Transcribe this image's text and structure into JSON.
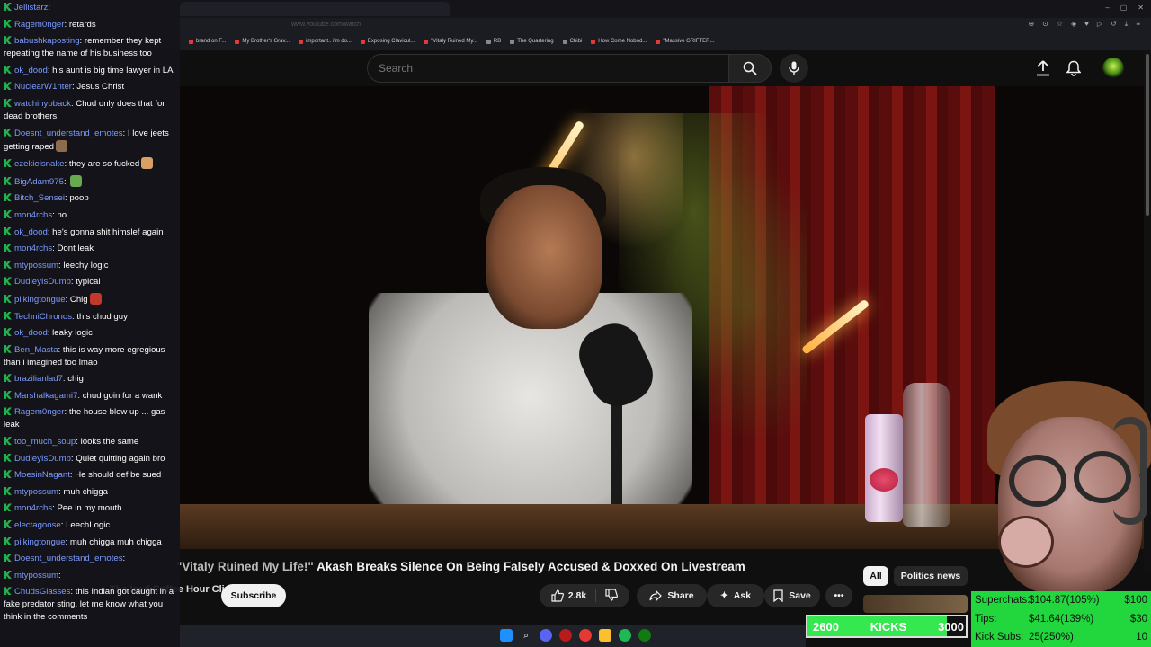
{
  "browser": {
    "url": "www.youtube.com/watch",
    "bookmarks": [
      "brand on F...",
      "My Brother's Grav...",
      "important.. i'm do...",
      "Exposing Clavicul...",
      "\"Vitaly Ruined My...",
      "RB",
      "The Quartering",
      "Chibi",
      "How Come Nobod...",
      "\"Massive GRIFTER..."
    ]
  },
  "header": {
    "search_placeholder": "Search"
  },
  "chat": {
    "messages": [
      {
        "user": "Jellistarz",
        "text": ""
      },
      {
        "user": "Ragem0nger",
        "text": "retards"
      },
      {
        "user": "babushkaposting",
        "text": "remember they kept repeating the name of his business too"
      },
      {
        "user": "ok_dood",
        "text": "his aunt is big time lawyer in LA"
      },
      {
        "user": "NuclearW1nter",
        "text": "Jesus Christ"
      },
      {
        "user": "watchinyoback",
        "text": "Chud only does that for dead brothers"
      },
      {
        "user": "Doesnt_understand_emotes",
        "text": "I love jeets getting raped"
      },
      {
        "user": "ezekielsnake",
        "text": "they are so fucked"
      },
      {
        "user": "BigAdam975",
        "text": ""
      },
      {
        "user": "Bitch_Sensei",
        "text": "poop"
      },
      {
        "user": "mon4rchs",
        "text": "no"
      },
      {
        "user": "ok_dood",
        "text": "he's gonna shit himslef again"
      },
      {
        "user": "mon4rchs",
        "text": "Dont leak"
      },
      {
        "user": "mtypossum",
        "text": "leechy logic"
      },
      {
        "user": "DudleyIsDumb",
        "text": "typical"
      },
      {
        "user": "pilkingtongue",
        "text": "Chig"
      },
      {
        "user": "TechniChronos",
        "text": "this chud guy"
      },
      {
        "user": "ok_dood",
        "text": "leaky logic"
      },
      {
        "user": "Ben_Masta",
        "text": "this is way more egregious than i imagined too lmao"
      },
      {
        "user": "brazilianlad7",
        "text": "chig"
      },
      {
        "user": "Marshalkagami7",
        "text": "chud goin for a wank"
      },
      {
        "user": "Ragem0nger",
        "text": "the house blew up ... gas leak"
      },
      {
        "user": "too_much_soup",
        "text": "looks the same"
      },
      {
        "user": "DudleyIsDumb",
        "text": "Quiet quitting again bro"
      },
      {
        "user": "MoesinNagant",
        "text": "He should def be sued"
      },
      {
        "user": "mtypossum",
        "text": "muh chigga"
      },
      {
        "user": "mon4rchs",
        "text": "Pee in my mouth"
      },
      {
        "user": "electagoose",
        "text": "LeechLogic"
      },
      {
        "user": "pilkingtongue",
        "text": "muh chigga muh chigga"
      },
      {
        "user": "Doesnt_understand_emotes",
        "text": ""
      },
      {
        "user": "mtypossum",
        "text": ""
      },
      {
        "user": "ChudsGlasses",
        "text": "this Indian got caught in a fake predator sting, let me know what you think in the comments"
      }
    ]
  },
  "video": {
    "overlay_quote": "\"Vitaly Ruined My Life!\"",
    "title": "Akash Breaks Silence On Being Falsely Accused & Doxxed On Livestream",
    "channel": "The Iced Coffee Hour Clips",
    "subscribe_label": "Subscribe",
    "likes": "2.8k",
    "share_label": "Share",
    "ask_label": "Ask",
    "save_label": "Save"
  },
  "sidebar_chips": {
    "all": "All",
    "politics": "Politics news"
  },
  "stream": {
    "kicks": {
      "start": "2600",
      "label": "KICKS",
      "goal": "3000",
      "progress": 0.88
    },
    "goals": [
      {
        "label": "Superchats:",
        "value": "$104.87(105%)",
        "target": "$100"
      },
      {
        "label": "Tips:",
        "value": "$41.64(139%)",
        "target": "$30"
      },
      {
        "label": "Kick Subs:",
        "value": "25(250%)",
        "target": "10"
      }
    ]
  },
  "colors": {
    "chat_username": "#7c9cff",
    "kick_green": "#22b14c",
    "goal_panel": "#22d63e",
    "youtube_bg": "#0f0f0f"
  }
}
